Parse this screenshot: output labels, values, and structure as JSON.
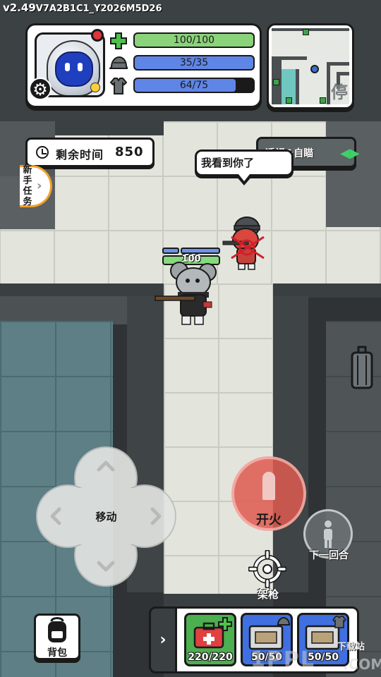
{
  "version": {
    "major": "v2.49",
    "build": "V7A2B1C1_Y2026M5D26"
  },
  "status": {
    "health": {
      "text": "100/100",
      "current": 100,
      "max": 100,
      "color": "#8ad37a"
    },
    "armor": {
      "text": "35/35",
      "current": 35,
      "max": 35,
      "color": "#5f86e6"
    },
    "vest": {
      "text": "64/75",
      "current": 64,
      "max": 75,
      "color": "#5f86e6"
    }
  },
  "minimap": {
    "marker": "停"
  },
  "timer": {
    "label": "剩余时间",
    "value": "850"
  },
  "newbie_task": {
    "label": "新手任务"
  },
  "speech": {
    "text": "我看到你了"
  },
  "xray": {
    "label": "透视&自瞄"
  },
  "player": {
    "hp": "100"
  },
  "controls": {
    "move_label": "移动",
    "fire_label": "开火",
    "next_round_label": "下一回合",
    "mount_label": "架枪",
    "backpack_label": "背包"
  },
  "items": [
    {
      "name": "medkit",
      "count": "220/220",
      "bg": "#4caf50"
    },
    {
      "name": "helmet-repair",
      "count": "50/50",
      "bg": "#3f6fe0"
    },
    {
      "name": "vest-repair",
      "count": "50/50",
      "bg": "#3f6fe0"
    }
  ],
  "watermark": {
    "site": "下载站",
    "logo": "1PPL",
    "com": ".COM"
  },
  "colors": {
    "accent": "#f0a02a",
    "fire": "#de5a50",
    "dark": "#1a1a1a"
  }
}
